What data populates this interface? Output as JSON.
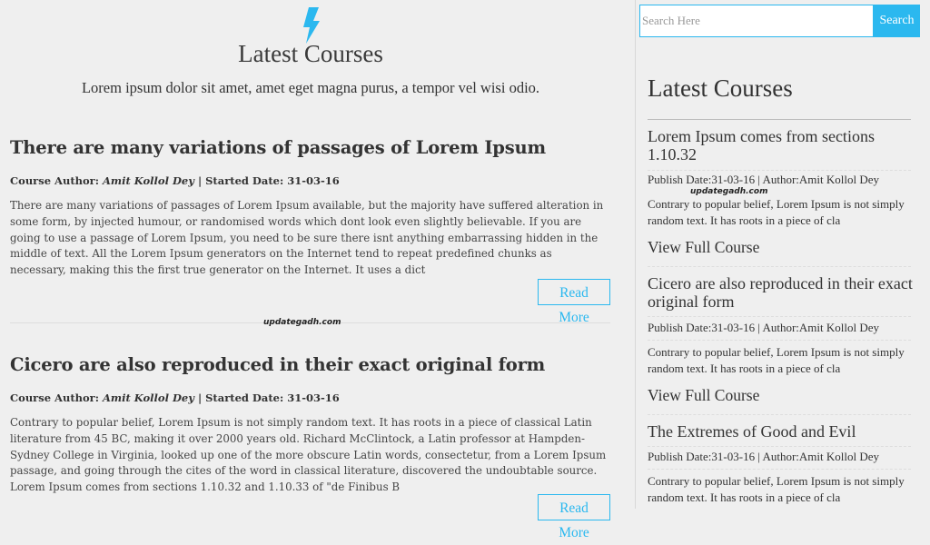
{
  "hero": {
    "icon": "lightning-bolt-icon",
    "title": "Latest Courses",
    "subtitle": "Lorem ipsum dolor sit amet, amet eget magna purus, a tempor vel wisi odio."
  },
  "posts": [
    {
      "title": "There are many variations of passages of Lorem Ipsum",
      "meta_prefix": "Course Author: ",
      "author": "Amit Kollol Dey",
      "meta_suffix": " | Started Date: 31-03-16",
      "body": "There are many variations of passages of Lorem Ipsum available, but the majority have suffered alteration in some form, by injected humour, or randomised words which dont look even slightly believable. If you are going to use a passage of Lorem Ipsum, you need to be sure there isnt anything embarrassing hidden in the middle of text. All the Lorem Ipsum generators on the Internet tend to repeat predefined chunks as necessary, making this the first true generator on the Internet. It uses a dict",
      "read_more": "Read More"
    },
    {
      "title": "Cicero are also reproduced in their exact original form",
      "meta_prefix": "Course Author: ",
      "author": "Amit Kollol Dey",
      "meta_suffix": " | Started Date: 31-03-16",
      "body": "Contrary to popular belief, Lorem Ipsum is not simply random text. It has roots in a piece of classical Latin literature from 45 BC, making it over 2000 years old. Richard McClintock, a Latin professor at Hampden-Sydney College in Virginia, looked up one of the more obscure Latin words, consectetur, from a Lorem Ipsum passage, and going through the cites of the word in classical literature, discovered the undoubtable source. Lorem Ipsum comes from sections 1.10.32 and 1.10.33 of \"de Finibus B",
      "read_more": "Read More"
    }
  ],
  "watermark": "updategadh.com",
  "search": {
    "placeholder": "Search Here",
    "button_label": "Search"
  },
  "sidebar": {
    "title": "Latest Courses",
    "items": [
      {
        "title": "Lorem Ipsum comes from sections 1.10.32",
        "meta": "Publish Date:31-03-16 | Author:Amit Kollol Dey",
        "excerpt": "Contrary to popular belief, Lorem Ipsum is not simply random text. It has roots in a piece of cla",
        "link": "View Full Course"
      },
      {
        "title": "Cicero are also reproduced in their exact original form",
        "meta": "Publish Date:31-03-16 | Author:Amit Kollol Dey",
        "excerpt": "Contrary to popular belief, Lorem Ipsum is not simply random text. It has roots in a piece of cla",
        "link": "View Full Course"
      },
      {
        "title": "The Extremes of Good and Evil",
        "meta": "Publish Date:31-03-16 | Author:Amit Kollol Dey",
        "excerpt": "Contrary to popular belief, Lorem Ipsum is not simply random text. It has roots in a piece of cla"
      }
    ]
  },
  "colors": {
    "accent": "#2bb8ef",
    "background": "#efefef",
    "text": "#333333"
  }
}
